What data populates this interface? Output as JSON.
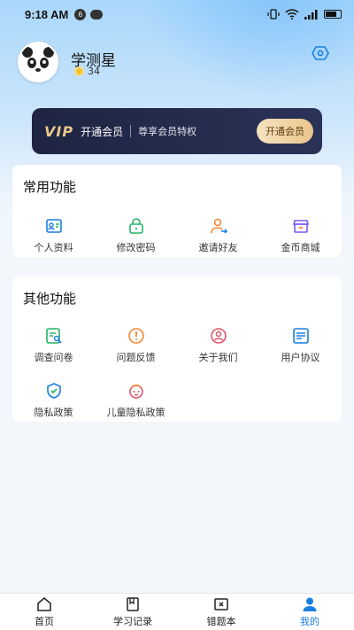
{
  "status_bar": {
    "time": "9:18 AM",
    "badge": "6"
  },
  "profile": {
    "name": "学测星",
    "coins": "34"
  },
  "vip": {
    "logo": "VIP",
    "title": "开通会员",
    "subtitle": "尊享会员特权",
    "button": "开通会员"
  },
  "common": {
    "title": "常用功能",
    "items": [
      {
        "label": "个人资料",
        "icon": "profile-card-icon"
      },
      {
        "label": "修改密码",
        "icon": "lock-icon"
      },
      {
        "label": "邀请好友",
        "icon": "invite-user-icon"
      },
      {
        "label": "金币商城",
        "icon": "store-icon"
      }
    ]
  },
  "other": {
    "title": "其他功能",
    "items": [
      {
        "label": "调查问卷",
        "icon": "survey-icon"
      },
      {
        "label": "问题反馈",
        "icon": "feedback-icon"
      },
      {
        "label": "关于我们",
        "icon": "about-icon"
      },
      {
        "label": "用户协议",
        "icon": "agreement-icon"
      },
      {
        "label": "隐私政策",
        "icon": "shield-icon"
      },
      {
        "label": "儿童隐私政策",
        "icon": "child-privacy-icon"
      }
    ]
  },
  "tabs": [
    {
      "label": "首页",
      "icon": "home-icon"
    },
    {
      "label": "学习记录",
      "icon": "study-record-icon"
    },
    {
      "label": "错题本",
      "icon": "mistake-book-icon"
    },
    {
      "label": "我的",
      "icon": "user-icon",
      "active": true
    }
  ],
  "colors": {
    "accent": "#1b7fe0",
    "green": "#27b36a",
    "orange": "#f2862f",
    "purple": "#7a5cf0",
    "gold": "#e9c98d"
  }
}
